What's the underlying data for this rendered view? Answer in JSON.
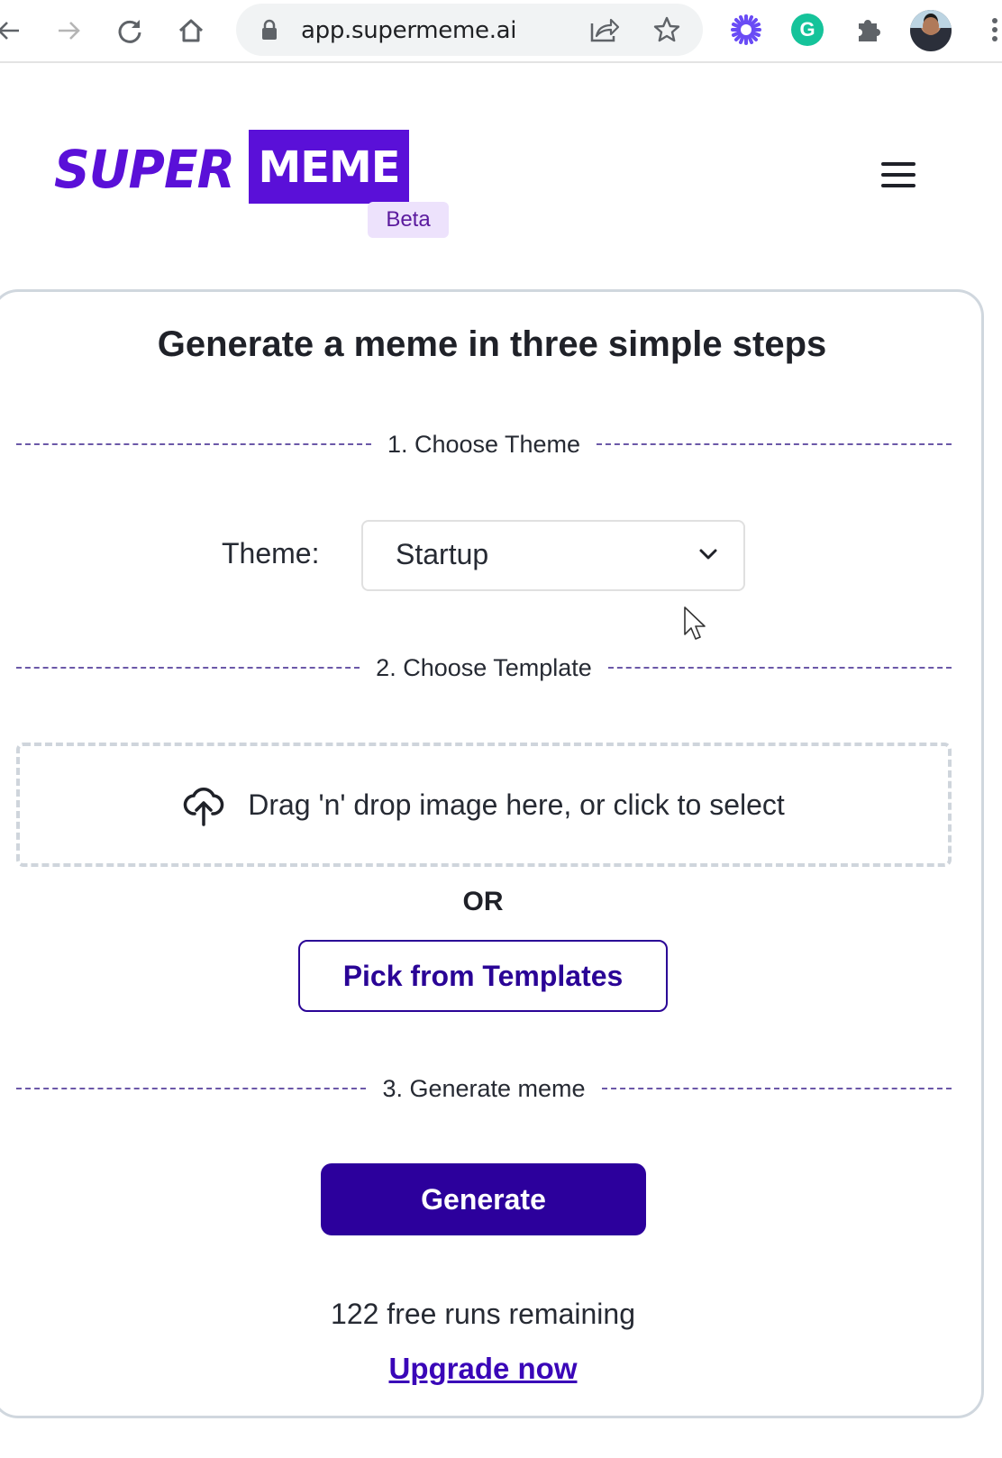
{
  "browser": {
    "url": "app.supermeme.ai",
    "icons": {
      "back": "arrow-left-icon",
      "forward": "arrow-right-icon",
      "reload": "reload-icon",
      "home": "home-icon",
      "lock": "lock-icon",
      "share": "share-icon",
      "bookmark": "star-icon",
      "extension1": "asterisk-extension-icon",
      "grammarly": "grammarly-icon",
      "extensions": "puzzle-icon",
      "profile": "avatar",
      "menu": "kebab-menu-icon"
    },
    "grammarly_letter": "G"
  },
  "header": {
    "logo_super": "SUPER",
    "logo_meme": "MEME",
    "badge": "Beta",
    "menu_icon": "hamburger-icon"
  },
  "colors": {
    "brand": "#5a10d8",
    "button_primary": "#2c009c",
    "link": "#3a06b8",
    "beta_bg": "#ede2fc",
    "divider": "#6b58a8"
  },
  "main": {
    "title": "Generate a meme in three simple steps",
    "steps": [
      {
        "label": "1. Choose Theme"
      },
      {
        "label": "2. Choose Template"
      },
      {
        "label": "3. Generate meme"
      }
    ],
    "theme": {
      "label": "Theme:",
      "selected": "Startup"
    },
    "dropzone": {
      "icon": "cloud-upload-icon",
      "text": "Drag 'n' drop image here, or click to select"
    },
    "or_text": "OR",
    "pick_templates_label": "Pick from Templates",
    "generate_label": "Generate",
    "runs_remaining": "122 free runs remaining",
    "upgrade_label": "Upgrade now"
  }
}
